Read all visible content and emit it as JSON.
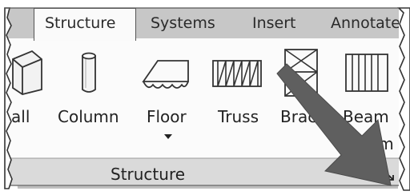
{
  "ribbon": {
    "tabs": [
      {
        "label": "Structure",
        "active": true
      },
      {
        "label": "Systems",
        "active": false
      },
      {
        "label": "Insert",
        "active": false
      },
      {
        "label": "Annotate",
        "active": false
      }
    ],
    "tools": [
      {
        "label": "all",
        "icon": "wall-icon"
      },
      {
        "label": "Column",
        "icon": "column-icon"
      },
      {
        "label": "Floor",
        "icon": "floor-icon",
        "has_dropdown": true
      },
      {
        "label": "Truss",
        "icon": "truss-icon"
      },
      {
        "label": "Brac",
        "icon": "brace-icon"
      },
      {
        "label": "Beam",
        "icon": "beam-system-icon",
        "second_line": "em"
      }
    ],
    "panel": {
      "title": "Structure",
      "launcher_icon": "dialog-launcher-icon"
    }
  },
  "annotation": {
    "arrow_icon": "pointer-arrow-icon",
    "arrow_color": "#606060"
  }
}
